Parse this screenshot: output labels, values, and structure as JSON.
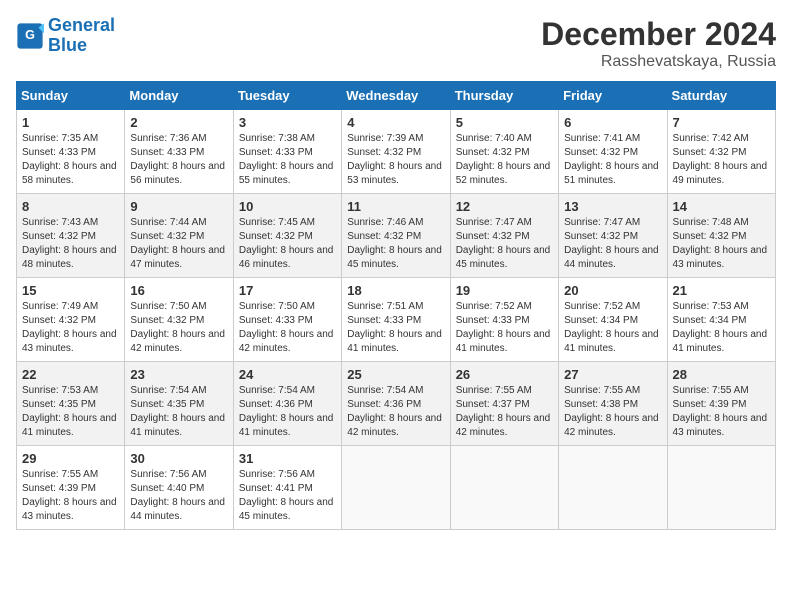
{
  "header": {
    "logo_line1": "General",
    "logo_line2": "Blue",
    "month": "December 2024",
    "location": "Rasshevatskaya, Russia"
  },
  "days_of_week": [
    "Sunday",
    "Monday",
    "Tuesday",
    "Wednesday",
    "Thursday",
    "Friday",
    "Saturday"
  ],
  "weeks": [
    [
      {
        "day": "1",
        "sunrise": "7:35 AM",
        "sunset": "4:33 PM",
        "daylight": "8 hours and 58 minutes."
      },
      {
        "day": "2",
        "sunrise": "7:36 AM",
        "sunset": "4:33 PM",
        "daylight": "8 hours and 56 minutes."
      },
      {
        "day": "3",
        "sunrise": "7:38 AM",
        "sunset": "4:33 PM",
        "daylight": "8 hours and 55 minutes."
      },
      {
        "day": "4",
        "sunrise": "7:39 AM",
        "sunset": "4:32 PM",
        "daylight": "8 hours and 53 minutes."
      },
      {
        "day": "5",
        "sunrise": "7:40 AM",
        "sunset": "4:32 PM",
        "daylight": "8 hours and 52 minutes."
      },
      {
        "day": "6",
        "sunrise": "7:41 AM",
        "sunset": "4:32 PM",
        "daylight": "8 hours and 51 minutes."
      },
      {
        "day": "7",
        "sunrise": "7:42 AM",
        "sunset": "4:32 PM",
        "daylight": "8 hours and 49 minutes."
      }
    ],
    [
      {
        "day": "8",
        "sunrise": "7:43 AM",
        "sunset": "4:32 PM",
        "daylight": "8 hours and 48 minutes."
      },
      {
        "day": "9",
        "sunrise": "7:44 AM",
        "sunset": "4:32 PM",
        "daylight": "8 hours and 47 minutes."
      },
      {
        "day": "10",
        "sunrise": "7:45 AM",
        "sunset": "4:32 PM",
        "daylight": "8 hours and 46 minutes."
      },
      {
        "day": "11",
        "sunrise": "7:46 AM",
        "sunset": "4:32 PM",
        "daylight": "8 hours and 45 minutes."
      },
      {
        "day": "12",
        "sunrise": "7:47 AM",
        "sunset": "4:32 PM",
        "daylight": "8 hours and 45 minutes."
      },
      {
        "day": "13",
        "sunrise": "7:47 AM",
        "sunset": "4:32 PM",
        "daylight": "8 hours and 44 minutes."
      },
      {
        "day": "14",
        "sunrise": "7:48 AM",
        "sunset": "4:32 PM",
        "daylight": "8 hours and 43 minutes."
      }
    ],
    [
      {
        "day": "15",
        "sunrise": "7:49 AM",
        "sunset": "4:32 PM",
        "daylight": "8 hours and 43 minutes."
      },
      {
        "day": "16",
        "sunrise": "7:50 AM",
        "sunset": "4:32 PM",
        "daylight": "8 hours and 42 minutes."
      },
      {
        "day": "17",
        "sunrise": "7:50 AM",
        "sunset": "4:33 PM",
        "daylight": "8 hours and 42 minutes."
      },
      {
        "day": "18",
        "sunrise": "7:51 AM",
        "sunset": "4:33 PM",
        "daylight": "8 hours and 41 minutes."
      },
      {
        "day": "19",
        "sunrise": "7:52 AM",
        "sunset": "4:33 PM",
        "daylight": "8 hours and 41 minutes."
      },
      {
        "day": "20",
        "sunrise": "7:52 AM",
        "sunset": "4:34 PM",
        "daylight": "8 hours and 41 minutes."
      },
      {
        "day": "21",
        "sunrise": "7:53 AM",
        "sunset": "4:34 PM",
        "daylight": "8 hours and 41 minutes."
      }
    ],
    [
      {
        "day": "22",
        "sunrise": "7:53 AM",
        "sunset": "4:35 PM",
        "daylight": "8 hours and 41 minutes."
      },
      {
        "day": "23",
        "sunrise": "7:54 AM",
        "sunset": "4:35 PM",
        "daylight": "8 hours and 41 minutes."
      },
      {
        "day": "24",
        "sunrise": "7:54 AM",
        "sunset": "4:36 PM",
        "daylight": "8 hours and 41 minutes."
      },
      {
        "day": "25",
        "sunrise": "7:54 AM",
        "sunset": "4:36 PM",
        "daylight": "8 hours and 42 minutes."
      },
      {
        "day": "26",
        "sunrise": "7:55 AM",
        "sunset": "4:37 PM",
        "daylight": "8 hours and 42 minutes."
      },
      {
        "day": "27",
        "sunrise": "7:55 AM",
        "sunset": "4:38 PM",
        "daylight": "8 hours and 42 minutes."
      },
      {
        "day": "28",
        "sunrise": "7:55 AM",
        "sunset": "4:39 PM",
        "daylight": "8 hours and 43 minutes."
      }
    ],
    [
      {
        "day": "29",
        "sunrise": "7:55 AM",
        "sunset": "4:39 PM",
        "daylight": "8 hours and 43 minutes."
      },
      {
        "day": "30",
        "sunrise": "7:56 AM",
        "sunset": "4:40 PM",
        "daylight": "8 hours and 44 minutes."
      },
      {
        "day": "31",
        "sunrise": "7:56 AM",
        "sunset": "4:41 PM",
        "daylight": "8 hours and 45 minutes."
      },
      null,
      null,
      null,
      null
    ]
  ]
}
